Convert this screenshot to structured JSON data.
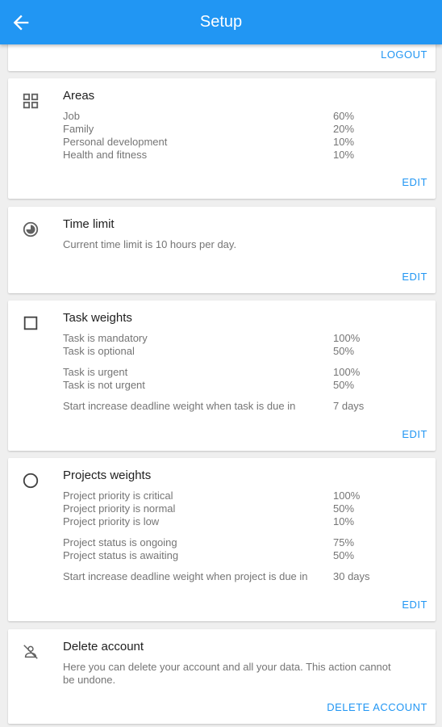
{
  "header": {
    "title": "Setup",
    "back_icon": "arrow-back-icon"
  },
  "account": {
    "logout_label": "LOGOUT"
  },
  "areas": {
    "icon": "grid-icon",
    "title": "Areas",
    "items": [
      {
        "label": "Job",
        "value": "60%"
      },
      {
        "label": "Family",
        "value": "20%"
      },
      {
        "label": "Personal development",
        "value": "10%"
      },
      {
        "label": "Health and fitness",
        "value": "10%"
      }
    ],
    "edit_label": "EDIT"
  },
  "time_limit": {
    "icon": "pie-timer-icon",
    "title": "Time limit",
    "description": "Current time limit is 10 hours per day.",
    "edit_label": "EDIT"
  },
  "task_weights": {
    "icon": "checkbox-outline-icon",
    "title": "Task weights",
    "items": [
      {
        "label": "Task is mandatory",
        "value": "100%"
      },
      {
        "label": "Task is optional",
        "value": "50%"
      },
      {
        "label": "Task is urgent",
        "value": "100%"
      },
      {
        "label": "Task is not urgent",
        "value": "50%"
      },
      {
        "label": "Start increase deadline weight when task is due in",
        "value": "7 days"
      }
    ],
    "edit_label": "EDIT"
  },
  "project_weights": {
    "icon": "circle-outline-icon",
    "title": "Projects weights",
    "items": [
      {
        "label": "Project priority is critical",
        "value": "100%"
      },
      {
        "label": "Project priority is normal",
        "value": "50%"
      },
      {
        "label": "Project priority is low",
        "value": "10%"
      },
      {
        "label": "Project status is ongoing",
        "value": "75%"
      },
      {
        "label": "Project status is awaiting",
        "value": "50%"
      },
      {
        "label": "Start increase deadline weight when project is due in",
        "value": "30 days"
      }
    ],
    "edit_label": "EDIT"
  },
  "delete_account": {
    "icon": "person-off-icon",
    "title": "Delete account",
    "description_line1": "Here you can delete your account and all your data. This action cannot",
    "description_line2": "be undone.",
    "action_label": "DELETE ACCOUNT"
  }
}
